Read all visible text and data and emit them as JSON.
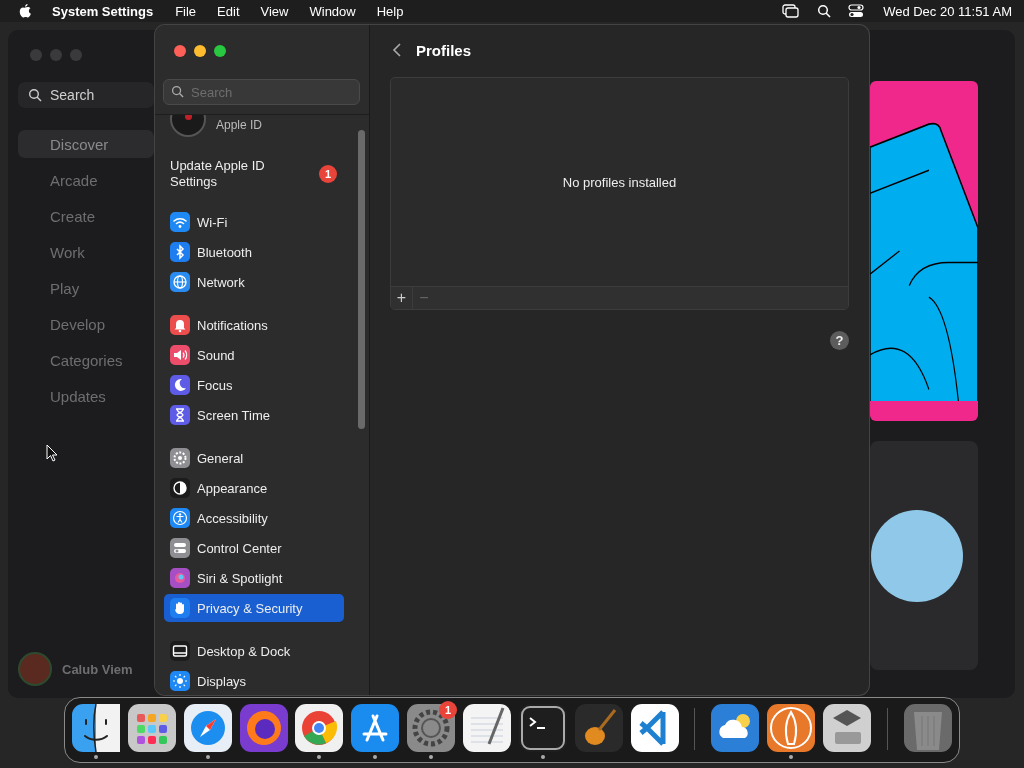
{
  "menu_bar": {
    "app_name": "System Settings",
    "menus": [
      "File",
      "Edit",
      "View",
      "Window",
      "Help"
    ],
    "clock": "Wed Dec 20  11:51 AM"
  },
  "background_window": {
    "search": {
      "placeholder": "Search"
    },
    "nav": [
      {
        "label": "Discover",
        "selected": true
      },
      {
        "label": "Arcade",
        "selected": false
      },
      {
        "label": "Create",
        "selected": false
      },
      {
        "label": "Work",
        "selected": false
      },
      {
        "label": "Play",
        "selected": false
      },
      {
        "label": "Develop",
        "selected": false
      },
      {
        "label": "Categories",
        "selected": false
      },
      {
        "label": "Updates",
        "selected": false
      }
    ],
    "user": {
      "name": "Calub Viem"
    }
  },
  "settings_window": {
    "search": {
      "placeholder": "Search"
    },
    "account": {
      "label": "Apple ID"
    },
    "notice": {
      "label": "Update Apple ID Settings",
      "badge": "1"
    },
    "groups": [
      [
        {
          "label": "Wi-Fi",
          "color": "#1e88f5",
          "selected": false
        },
        {
          "label": "Bluetooth",
          "color": "#1e7ef0",
          "selected": false
        },
        {
          "label": "Network",
          "color": "#2a8cf0",
          "selected": false
        }
      ],
      [
        {
          "label": "Notifications",
          "color": "#ec4d4d",
          "selected": false
        },
        {
          "label": "Sound",
          "color": "#ec4d6b",
          "selected": false
        },
        {
          "label": "Focus",
          "color": "#5e5ce6",
          "selected": false
        },
        {
          "label": "Screen Time",
          "color": "#5e5ce6",
          "selected": false
        }
      ],
      [
        {
          "label": "General",
          "color": "#8e8e93",
          "selected": false
        },
        {
          "label": "Appearance",
          "color": "#1c1c1c",
          "selected": false
        },
        {
          "label": "Accessibility",
          "color": "#1e88f5",
          "selected": false
        },
        {
          "label": "Control Center",
          "color": "#8e8e93",
          "selected": false
        },
        {
          "label": "Siri & Spotlight",
          "color": "#a64fc4",
          "selected": false
        },
        {
          "label": "Privacy & Security",
          "color": "#1e7ef0",
          "selected": true
        }
      ],
      [
        {
          "label": "Desktop & Dock",
          "color": "#1c1c1c",
          "selected": false
        },
        {
          "label": "Displays",
          "color": "#1e88f5",
          "selected": false
        }
      ]
    ],
    "page": {
      "title": "Profiles",
      "empty_message": "No profiles installed",
      "add": "+",
      "remove": "−",
      "help": "?"
    }
  },
  "dock": {
    "groups": [
      [
        {
          "color": "#3aa0f0",
          "running": true
        },
        {
          "color": "#c8c8c8",
          "running": false
        },
        {
          "color": "#e8eef5",
          "running": true
        },
        {
          "color": "#7a3ccf",
          "running": false
        },
        {
          "color": "#f0f0f0",
          "running": true
        },
        {
          "color": "#1a8cf0",
          "running": true
        },
        {
          "color": "#8a8a8a",
          "running": true,
          "badge": "1"
        },
        {
          "color": "#f4f4f4",
          "running": false
        },
        {
          "color": "#1e1e1e",
          "running": true
        },
        {
          "color": "#2a2a2a",
          "running": false
        },
        {
          "color": "#ffffff",
          "running": false
        }
      ],
      [
        {
          "color": "#2c7fd6",
          "running": false
        },
        {
          "color": "#e8782a",
          "running": true
        },
        {
          "color": "#d0d0d0",
          "running": false
        }
      ],
      [
        {
          "color": "#6a6a6a",
          "running": false
        }
      ]
    ]
  }
}
